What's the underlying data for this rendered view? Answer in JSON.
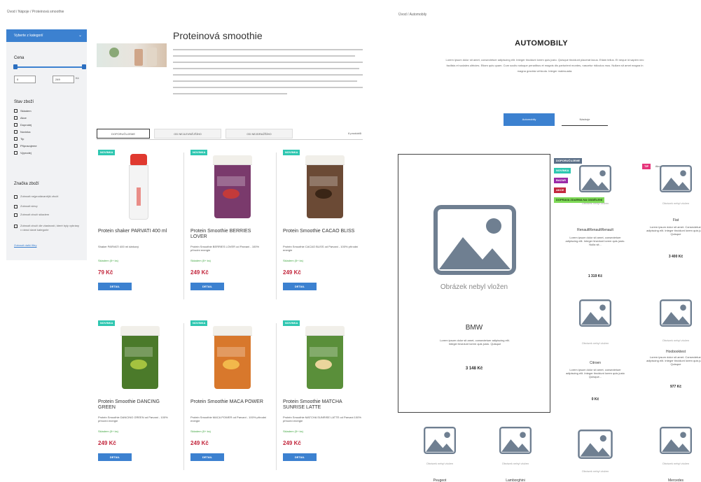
{
  "left": {
    "breadcrumb": "Úvod  /  Nápoje  /  Proteinová smoothie",
    "sidebar": {
      "dropdown_label": "Vyberte z kategorií",
      "price_heading": "Cena",
      "price_min": "0",
      "price_max": "249",
      "price_unit": "Kč",
      "stock_heading": "Stav zboží",
      "stock_items": [
        "Skladem",
        "Akce",
        "Doprodej",
        "Novinka",
        "Tip",
        "Připravujeme",
        "Výprodej"
      ],
      "brand_heading": "Značka zboží",
      "brand_items": [
        "Zobrazit nejprodávanější zboží",
        "Zobrazit slevy",
        "Zobrazit zboží skladem",
        "Zobrazit zboží dle vlastností, které byly vybrány v rámci dané kategorie"
      ],
      "more_link": "Zobrazit další filtry"
    },
    "category_title": "Proteinová smoothie",
    "sort_tabs": [
      "DOPORUČUJEME",
      "OD NEJLEVNĚJŠÍHO",
      "OD NEJDRAŽŠÍHO"
    ],
    "product_count": "6 produktů",
    "products": [
      {
        "badge": "NOVINKA",
        "name": "Protein shaker PARVATI 400 ml",
        "desc": "Shaker PARVATI 400 ml dárkový",
        "stock": "Skladem (5+ ks)",
        "price": "79 Kč",
        "button": "DETAIL",
        "kind": "shaker"
      },
      {
        "badge": "NOVINKA",
        "name": "Protein Smoothie BERRIES LOVER",
        "desc": "Protein Smoothie BERRIES LOVER od Parvani - 100% přírodní energie",
        "stock": "Skladem (5+ ks)",
        "price": "249 Kč",
        "button": "DETAIL",
        "kind": "jar"
      },
      {
        "badge": "NOVINKA",
        "name": "Protein Smoothie CACAO BLISS",
        "desc": "Protein Smoothie CACAO BLISS od Parvani - 100% přírodní energie",
        "stock": "Skladem (5+ ks)",
        "price": "249 Kč",
        "button": "DETAIL",
        "kind": "jar"
      },
      {
        "badge": "NOVINKA",
        "name": "Protein Smoothie DANCING GREEN",
        "desc": "Protein Smoothie DANCING GREEN od Parvani - 100% přírodní energie",
        "stock": "Skladem (5+ ks)",
        "price": "249 Kč",
        "button": "DETAIL",
        "kind": "jar"
      },
      {
        "badge": "NOVINKA",
        "name": "Protein Smoothie MACA POWER",
        "desc": "Protein Smoothie MACA POWER od Parvani - 100% přírodní energie",
        "stock": "Skladem (5+ ks)",
        "price": "249 Kč",
        "button": "DETAIL",
        "kind": "jar"
      },
      {
        "badge": "NOVINKA",
        "name": "Protein Smoothie MATCHA SUNRISE LATTE",
        "desc": "Protein Smoothie MATCHA SUNRISE LATTE od Parvani 100% přírodní energie",
        "stock": "Skladem (5+ ks)",
        "price": "249 Kč",
        "button": "DETAIL",
        "kind": "jar"
      }
    ],
    "colors": {
      "badge": "#2fc7b1",
      "accent": "#3c81d0",
      "price": "#c3273d",
      "stock": "#40a640"
    }
  },
  "right": {
    "breadcrumb": "Úvod  /  Automobily",
    "title": "AUTOMOBILY",
    "description": "Lorem ipsum dolor sit amet, consectetuer adipiscing elit. Integer tincidunt lorem quis justo. Quisque tincidunt placerat lacus. Etiam tellus. Et neque id sapien nec facilisis et sodales ultricies. Etiam quis quam. Cum sociis natoque penatibus et magnis dis parturient montes, nascetur ridiculus mus. Nullam sit amet magna in magna gravida vehicula. Integer malesuada.",
    "tabs": [
      "Automobily",
      "Nástroje"
    ],
    "featured": {
      "no_image_text": "Obrázek nebyl vložen",
      "name": "BMW",
      "desc": "Lorem ipsum dolor sit amet, consectetuer adipiscing elit. Integer tincidunt lorem quis justo. Quisque",
      "price": "3 148 Kč"
    },
    "badges": [
      {
        "label": "DOPORUČUJEME",
        "color": "#5b6f87"
      },
      {
        "label": "NOVINKA",
        "color": "#2fc7b1"
      },
      {
        "label": "BAZAR",
        "color": "#9b2aa8"
      },
      {
        "label": "AKCE",
        "color": "#c3273d"
      },
      {
        "label": "DOPRAVA ZDARMA NA ODDĚLENÍ",
        "color": "#7ed957"
      }
    ],
    "tip_badge": "TIP",
    "tip_extra": "Akce",
    "grid": [
      {
        "nip": "Obrázek nebyl vložen",
        "name": "RenaultRenaultRenault",
        "desc": "Lorem ipsum dolor sit amet, consectetuer adipiscing elit. Integer tincidunt lorem quis justo. Nulla sit...",
        "price": "1 319 Kč"
      },
      {
        "nip": "Obrázek nebyl vložen",
        "name": "Fiat",
        "desc": "Lorem ipsum dolor sit amet. Consectetuer adipiscing elit. Integer tincidunt lorem quis justo Quisque",
        "price": "3 400 Kč"
      },
      {
        "nip": "Obrázek nebyl vložen",
        "name": "Citroen",
        "desc": "Lorem ipsum dolor sit amet, consectetuer adipiscing elit. Integer tincidunt lorem quis justo Quisque...",
        "price": "0 Kč"
      },
      {
        "nip": "Obrázek nebyl vložen",
        "name": "Hoobooktest",
        "desc": "Lorem ipsum dolor sit amet. Consectetuer adipiscing elit. Integer tincidunt lorem quis justo Quisque",
        "price": "977 Kč"
      },
      {
        "nip": "Obrázek nebyl vložen",
        "name": "Peugeot",
        "desc": "",
        "price": ""
      },
      {
        "nip": "Obrázek nebyl vložen",
        "name": "Lamborghini",
        "desc": "",
        "price": ""
      },
      {
        "nip": "Obrázek nebyl vložen",
        "name": "",
        "desc": "",
        "price": ""
      },
      {
        "nip": "Obrázek nebyl vložen",
        "name": "Mercedes",
        "desc": "",
        "price": ""
      }
    ]
  }
}
